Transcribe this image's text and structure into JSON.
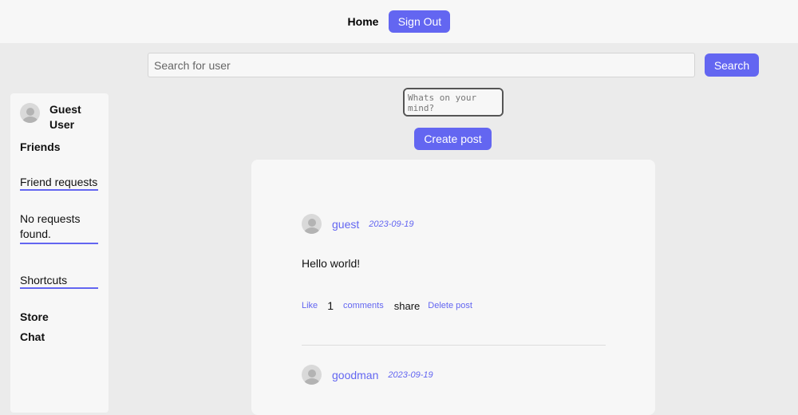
{
  "nav": {
    "home_label": "Home",
    "signout_label": "Sign Out"
  },
  "search": {
    "placeholder": "Search for user",
    "value": "",
    "button_label": "Search"
  },
  "sidebar": {
    "user_name": "Guest User",
    "friends_label": "Friends",
    "friend_requests_label": "Friend requests",
    "no_requests_text": "No requests found.",
    "shortcuts_label": "Shortcuts",
    "store_label": "Store",
    "chat_label": "Chat"
  },
  "composer": {
    "placeholder": "Whats on your mind?",
    "value": "",
    "button_label": "Create post"
  },
  "posts": [
    {
      "author": "guest",
      "date": "2023-09-19",
      "text": "Hello world!",
      "like_label": "Like",
      "comment_count": "1",
      "comments_label": "comments",
      "share_label": "share",
      "delete_label": "Delete post"
    },
    {
      "author": "goodman",
      "date": "2023-09-19"
    }
  ],
  "colors": {
    "accent": "#6366f1",
    "background": "#ebebeb",
    "card": "#f7f7f7"
  },
  "icons": {
    "avatar": "user-avatar-icon"
  }
}
